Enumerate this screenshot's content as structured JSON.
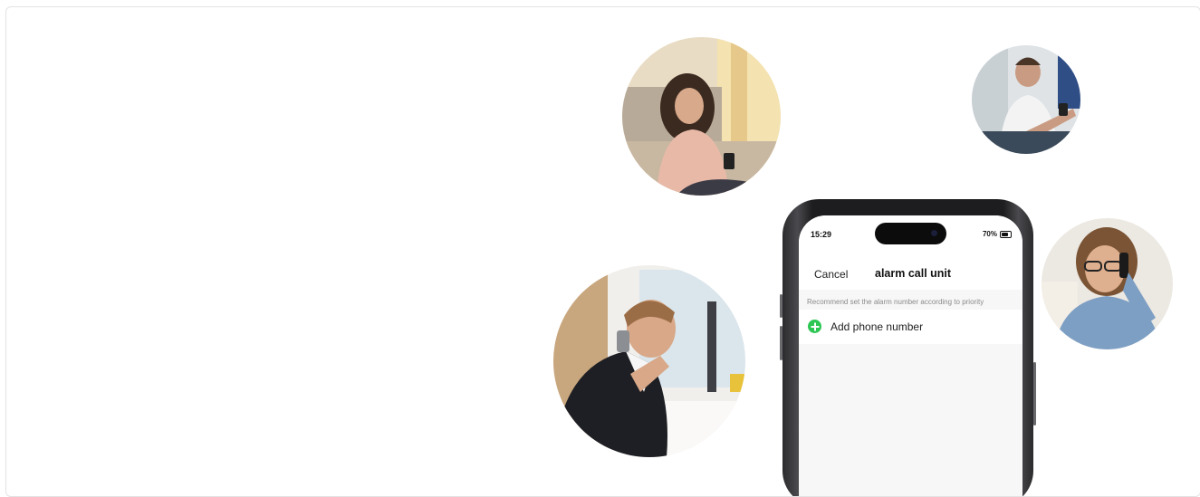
{
  "phone": {
    "status_time": "15:29",
    "battery_text": "70%",
    "cancel_label": "Cancel",
    "screen_title": "alarm call unit",
    "hint_text": "Recommend set the alarm number according to priority",
    "add_label": "Add phone number",
    "accent_color": "#2dc653",
    "add_icon": "plus-circle-icon"
  }
}
